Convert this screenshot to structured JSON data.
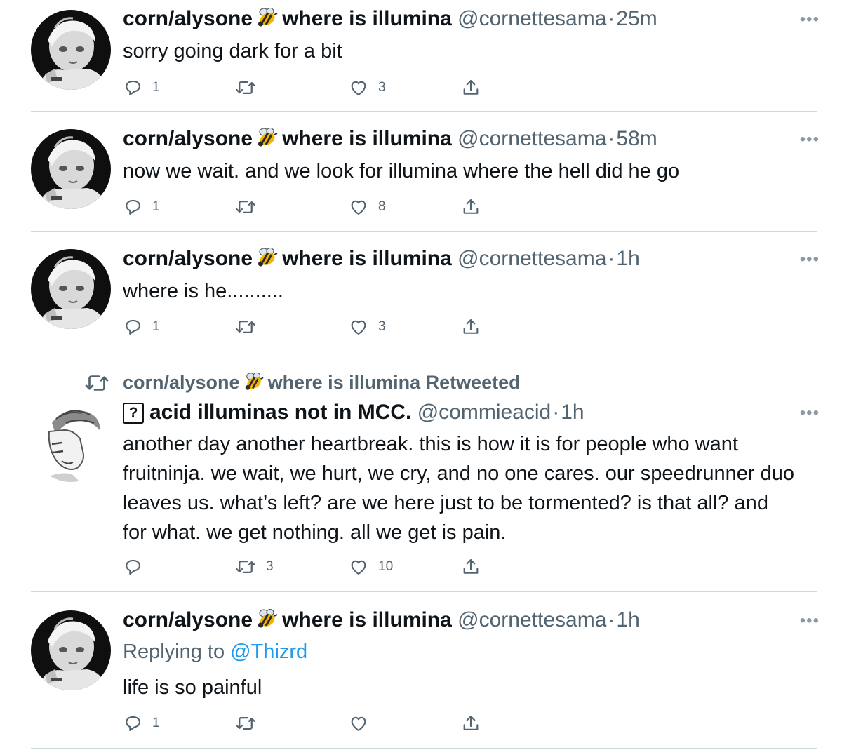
{
  "tweets": [
    {
      "author": "corn/alysone",
      "author_suffix": "where is illumina",
      "handle": "@cornettesama",
      "time": "25m",
      "text": "sorry going dark for a bit",
      "replies": "1",
      "retweets": "",
      "likes": "3"
    },
    {
      "author": "corn/alysone",
      "author_suffix": "where is illumina",
      "handle": "@cornettesama",
      "time": "58m",
      "text": "now we wait. and we look for illumina where the hell did he go",
      "replies": "1",
      "retweets": "",
      "likes": "8"
    },
    {
      "author": "corn/alysone",
      "author_suffix": "where is illumina",
      "handle": "@cornettesama",
      "time": "1h",
      "text": "where is he..........",
      "replies": "1",
      "retweets": "",
      "likes": "3"
    },
    {
      "retweeted_by": "corn/alysone",
      "retweeted_by_suffix": "where is illumina Retweeted",
      "author_icon": "question-box-icon",
      "author": "acid illuminas not in MCC.",
      "handle": "@commieacid",
      "time": "1h",
      "text": "another day another heartbreak. this is how it is for people who want fruitninja. we wait, we hurt, we cry, and no one cares. our speedrunner duo leaves us. what’s left? are we here just to be tormented? is that all? and for what. we get nothing. all we get is pain.",
      "replies": "",
      "retweets": "3",
      "likes": "10"
    },
    {
      "author": "corn/alysone",
      "author_suffix": "where is illumina",
      "handle": "@cornettesama",
      "time": "1h",
      "replying_label": "Replying to",
      "replying_to": "@Thizrd",
      "text": "life is so painful",
      "replies": "1",
      "retweets": "",
      "likes": ""
    }
  ],
  "separator": "·",
  "more_glyph": "•••",
  "colors": {
    "text": "#0f1419",
    "secondary": "#536471",
    "link": "#1d9bf0",
    "divider": "#cfd9de"
  }
}
